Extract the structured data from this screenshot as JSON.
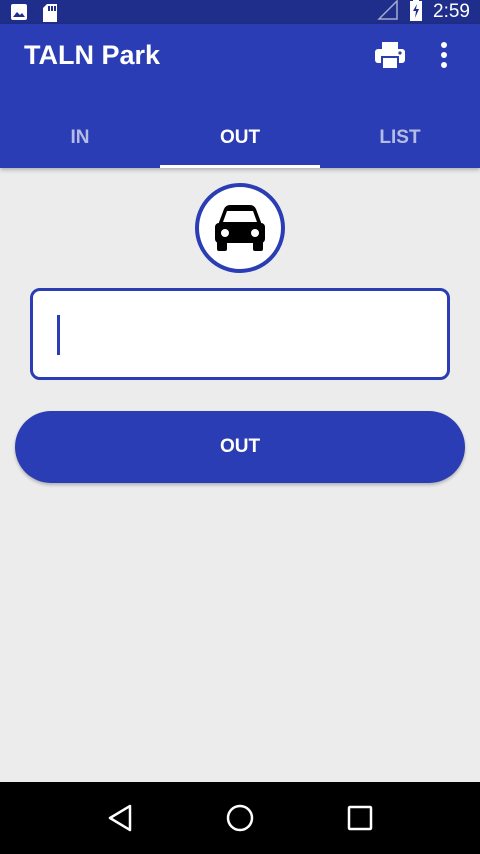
{
  "status_bar": {
    "time": "2:59",
    "icons": [
      "image-icon",
      "sd-card-icon",
      "signal-icon",
      "battery-charging-icon"
    ]
  },
  "app_bar": {
    "title": "TALN Park",
    "actions": [
      "print-icon",
      "more-vert-icon"
    ]
  },
  "tabs": [
    {
      "label": "IN",
      "active": false
    },
    {
      "label": "OUT",
      "active": true
    },
    {
      "label": "LIST",
      "active": false
    }
  ],
  "main": {
    "icon": "car-icon",
    "plate_input": {
      "value": "",
      "placeholder": ""
    },
    "out_button_label": "OUT"
  },
  "nav_bar": {
    "buttons": [
      "back-icon",
      "home-icon",
      "recents-icon"
    ]
  },
  "colors": {
    "primary": "#2a3db4",
    "primary_dark": "#1f2e8a",
    "background": "#ececec"
  }
}
